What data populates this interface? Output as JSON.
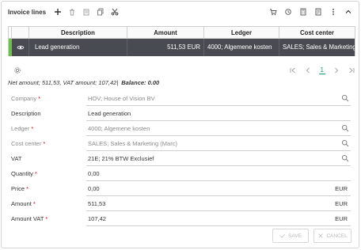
{
  "toolbar": {
    "title": "Invoice lines",
    "left_icons": [
      "plus-icon",
      "trash-icon",
      "copy-icon",
      "document-icon",
      "scissors-icon"
    ],
    "right_icons": [
      "cart-icon",
      "refresh-icon",
      "calculator-icon",
      "report-icon",
      "more-icon",
      "collapse-icon"
    ]
  },
  "grid": {
    "columns": [
      "",
      "",
      "Description",
      "Amount",
      "Ledger",
      "Cost center"
    ],
    "rows": [
      {
        "description": "Lead generation",
        "amount": "511,53 EUR",
        "ledger": "4000; Algemene kosten",
        "cost_center": "SALES; Sales & Marketing (",
        "selected": true
      }
    ]
  },
  "pager": {
    "current_page": "1",
    "icons": [
      "first-page-icon",
      "prev-page-icon",
      "next-page-icon",
      "last-page-icon"
    ]
  },
  "summary": {
    "text": "Net amount; 511,53, VAT amount; 107,42|",
    "balance": "Balance: 0.00"
  },
  "form": {
    "company": {
      "label": "Company",
      "value": "HOV; House of Vision BV"
    },
    "description": {
      "label": "Description",
      "value": "Lead generation"
    },
    "ledger": {
      "label": "Ledger",
      "value": "4000; Algemene kosten"
    },
    "cost_center": {
      "label": "Cost center",
      "value": "SALES; Sales & Marketing (Marc)"
    },
    "vat": {
      "label": "VAT",
      "value": "21E; 21% BTW Exclusief"
    },
    "quantity": {
      "label": "Quantity",
      "value": "0,00"
    },
    "price": {
      "label": "Price",
      "value": "0,00",
      "suffix": "EUR"
    },
    "amount": {
      "label": "Amount",
      "value": "511,53",
      "suffix": "EUR"
    },
    "amount_vat": {
      "label": "Amount VAT",
      "value": "107,42",
      "suffix": "EUR"
    }
  },
  "buttons": {
    "save": "SAVE",
    "cancel": "CANCEL"
  },
  "colors": {
    "selected_row_bg": "#484b52",
    "row_accent": "#6cc04a",
    "required": "#d0021b",
    "pager_active": "#1a9b75"
  }
}
